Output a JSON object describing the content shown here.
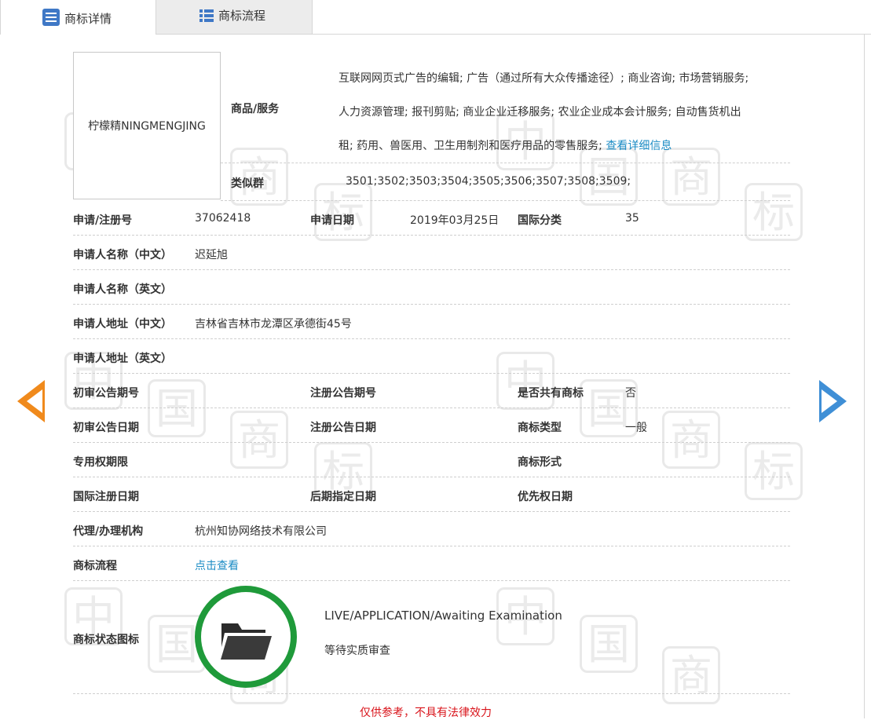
{
  "tabs": [
    {
      "label": "商标详情",
      "icon": "list-detail-icon"
    },
    {
      "label": "商标流程",
      "icon": "flow-list-icon"
    }
  ],
  "trademark": {
    "name_image_text": "柠檬精NINGMENGJING",
    "goods_label": "商品/服务",
    "goods_line1": "互联网网页式广告的编辑; 广告（通过所有大众传播途径）; 商业咨询; 市场营销服务;",
    "goods_line2": "人力资源管理; 报刊剪贴; 商业企业迁移服务; 农业企业成本会计服务; 自动售货机出",
    "goods_line3": "租; 药用、兽医用、卫生用制剂和医疗用品的零售服务; ",
    "goods_more_link": "查看详细信息",
    "similar_label": "类似群",
    "similar_value": "3501;3502;3503;3504;3505;3506;3507;3508;3509;",
    "reg_no_label": "申请/注册号",
    "reg_no_value": "37062418",
    "apply_date_label": "申请日期",
    "apply_date_value": "2019年03月25日",
    "intl_class_label": "国际分类",
    "intl_class_value": "35",
    "applicant_cn_label": "申请人名称（中文）",
    "applicant_cn_value": "迟延旭",
    "applicant_en_label": "申请人名称（英文）",
    "address_cn_label": "申请人地址（中文）",
    "address_cn_value": "吉林省吉林市龙潭区承德街45号",
    "address_en_label": "申请人地址（英文）",
    "prelim_no_label": "初审公告期号",
    "reg_pub_no_label": "注册公告期号",
    "shared_label": "是否共有商标",
    "shared_value": "否",
    "prelim_date_label": "初审公告日期",
    "reg_pub_date_label": "注册公告日期",
    "tm_type_label": "商标类型",
    "tm_type_value": "一般",
    "exclusive_label": "专用权期限",
    "tm_form_label": "商标形式",
    "intl_reg_date_label": "国际注册日期",
    "later_date_label": "后期指定日期",
    "priority_label": "优先权日期",
    "agent_label": "代理/办理机构",
    "agent_value": "杭州知协网络技术有限公司",
    "flow_label": "商标流程",
    "flow_link": "点击查看",
    "status_label": "商标状态图标",
    "status_en": "LIVE/APPLICATION/Awaiting Examination",
    "status_cn": "等待实质审查"
  },
  "disclaimer": "仅供参考，不具有法律效力",
  "colors": {
    "link": "#1a8bc4",
    "status_green": "#1f9a3a",
    "prev_arrow": "#f08a1c",
    "next_arrow": "#3f8fd6",
    "disclaimer_red": "#d9141b"
  }
}
